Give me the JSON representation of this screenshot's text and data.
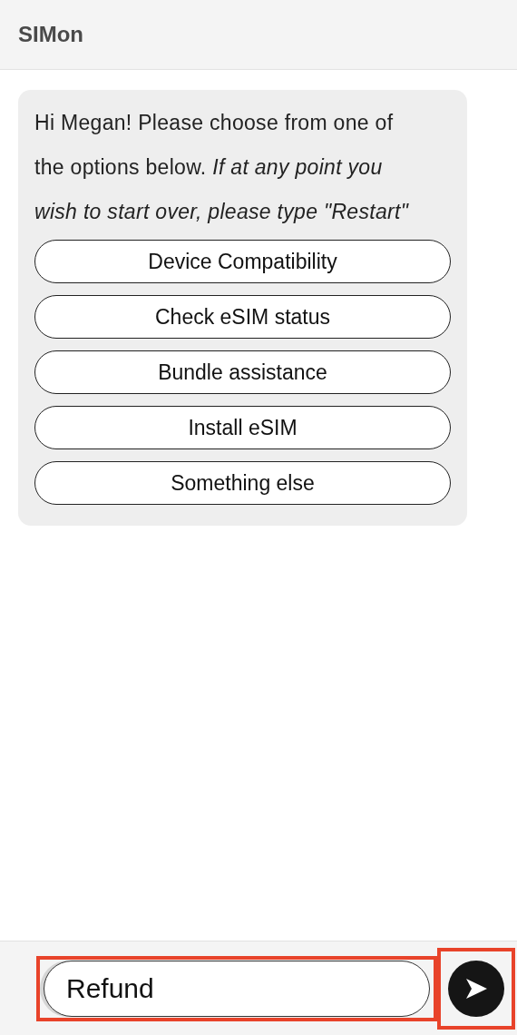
{
  "header": {
    "title": "SIMon"
  },
  "message": {
    "text": "Hi Megan! Please choose from one of the options below. *If at any point you wish to start over, please type \"Restart\"*",
    "options": [
      "Device Compatibility",
      "Check eSIM status",
      "Bundle assistance",
      "Install eSIM",
      "Something else"
    ]
  },
  "composer": {
    "value": "Refund",
    "highlighted": true
  }
}
